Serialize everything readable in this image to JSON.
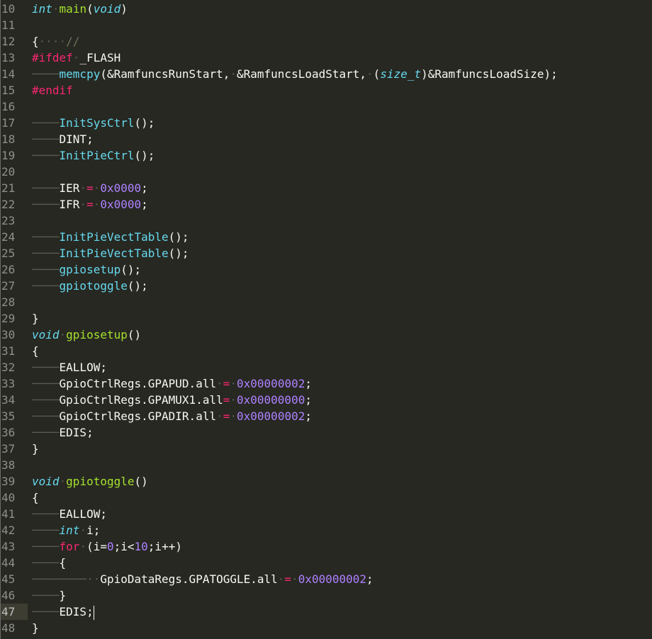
{
  "editor": {
    "theme": {
      "background": "#272822",
      "active_gutter": "#3e3d32"
    },
    "lines": [
      {
        "n": "10",
        "tokens": [
          [
            "kw",
            "int"
          ],
          [
            "ws",
            "·"
          ],
          [
            "fn",
            "main"
          ],
          [
            "id",
            "("
          ],
          [
            "kw",
            "void"
          ],
          [
            "id",
            ")"
          ]
        ]
      },
      {
        "n": "11",
        "tokens": []
      },
      {
        "n": "12",
        "tokens": [
          [
            "id",
            "{"
          ],
          [
            "ws",
            "····"
          ],
          [
            "cm",
            "//"
          ]
        ]
      },
      {
        "n": "13",
        "tokens": [
          [
            "pre",
            "#ifdef"
          ],
          [
            "ws",
            "·"
          ],
          [
            "id",
            "_FLASH"
          ]
        ]
      },
      {
        "n": "14",
        "tokens": [
          [
            "tab",
            "────"
          ],
          [
            "call",
            "memcpy"
          ],
          [
            "id",
            "(&RamfuncsRunStart,"
          ],
          [
            "ws",
            "·"
          ],
          [
            "id",
            "&RamfuncsLoadStart,"
          ],
          [
            "ws",
            "·"
          ],
          [
            "id",
            "("
          ],
          [
            "kw",
            "size_t"
          ],
          [
            "id",
            ")&RamfuncsLoadSize);"
          ]
        ]
      },
      {
        "n": "15",
        "tokens": [
          [
            "pre",
            "#endif"
          ]
        ]
      },
      {
        "n": "16",
        "tokens": []
      },
      {
        "n": "17",
        "tokens": [
          [
            "tab",
            "────"
          ],
          [
            "call",
            "InitSysCtrl"
          ],
          [
            "id",
            "();"
          ]
        ]
      },
      {
        "n": "18",
        "tokens": [
          [
            "tab",
            "────"
          ],
          [
            "id",
            "DINT;"
          ]
        ]
      },
      {
        "n": "19",
        "tokens": [
          [
            "tab",
            "────"
          ],
          [
            "call",
            "InitPieCtrl"
          ],
          [
            "id",
            "();"
          ]
        ]
      },
      {
        "n": "20",
        "tokens": []
      },
      {
        "n": "21",
        "tokens": [
          [
            "tab",
            "────"
          ],
          [
            "id",
            "IER"
          ],
          [
            "ws",
            "·"
          ],
          [
            "ctl",
            "="
          ],
          [
            "ws",
            "·"
          ],
          [
            "num",
            "0x0000"
          ],
          [
            "id",
            ";"
          ]
        ]
      },
      {
        "n": "22",
        "tokens": [
          [
            "tab",
            "────"
          ],
          [
            "id",
            "IFR"
          ],
          [
            "ws",
            "·"
          ],
          [
            "ctl",
            "="
          ],
          [
            "ws",
            "·"
          ],
          [
            "num",
            "0x0000"
          ],
          [
            "id",
            ";"
          ]
        ]
      },
      {
        "n": "23",
        "tokens": []
      },
      {
        "n": "24",
        "tokens": [
          [
            "tab",
            "────"
          ],
          [
            "call",
            "InitPieVectTable"
          ],
          [
            "id",
            "();"
          ]
        ]
      },
      {
        "n": "25",
        "tokens": [
          [
            "tab",
            "────"
          ],
          [
            "call",
            "InitPieVectTable"
          ],
          [
            "id",
            "();"
          ]
        ]
      },
      {
        "n": "26",
        "tokens": [
          [
            "tab",
            "────"
          ],
          [
            "call",
            "gpiosetup"
          ],
          [
            "id",
            "();"
          ]
        ]
      },
      {
        "n": "27",
        "tokens": [
          [
            "tab",
            "────"
          ],
          [
            "call",
            "gpiotoggle"
          ],
          [
            "id",
            "();"
          ]
        ]
      },
      {
        "n": "28",
        "tokens": []
      },
      {
        "n": "29",
        "tokens": [
          [
            "id",
            "}"
          ]
        ]
      },
      {
        "n": "30",
        "tokens": [
          [
            "kw",
            "void"
          ],
          [
            "ws",
            "·"
          ],
          [
            "fn",
            "gpiosetup"
          ],
          [
            "id",
            "()"
          ]
        ]
      },
      {
        "n": "31",
        "tokens": [
          [
            "id",
            "{"
          ]
        ]
      },
      {
        "n": "32",
        "tokens": [
          [
            "tab",
            "────"
          ],
          [
            "id",
            "EALLOW;"
          ]
        ]
      },
      {
        "n": "33",
        "tokens": [
          [
            "tab",
            "────"
          ],
          [
            "id",
            "GpioCtrlRegs.GPAPUD.all"
          ],
          [
            "ws",
            "·"
          ],
          [
            "ctl",
            "="
          ],
          [
            "ws",
            "·"
          ],
          [
            "num",
            "0x00000002"
          ],
          [
            "id",
            ";"
          ]
        ]
      },
      {
        "n": "34",
        "tokens": [
          [
            "tab",
            "────"
          ],
          [
            "id",
            "GpioCtrlRegs.GPAMUX1.all"
          ],
          [
            "ctl",
            "="
          ],
          [
            "ws",
            "·"
          ],
          [
            "num",
            "0x00000000"
          ],
          [
            "id",
            ";"
          ]
        ]
      },
      {
        "n": "35",
        "tokens": [
          [
            "tab",
            "────"
          ],
          [
            "id",
            "GpioCtrlRegs.GPADIR.all"
          ],
          [
            "ws",
            "·"
          ],
          [
            "ctl",
            "="
          ],
          [
            "ws",
            "·"
          ],
          [
            "num",
            "0x00000002"
          ],
          [
            "id",
            ";"
          ]
        ]
      },
      {
        "n": "36",
        "tokens": [
          [
            "tab",
            "────"
          ],
          [
            "id",
            "EDIS;"
          ]
        ]
      },
      {
        "n": "37",
        "tokens": [
          [
            "id",
            "}"
          ]
        ]
      },
      {
        "n": "38",
        "tokens": []
      },
      {
        "n": "39",
        "tokens": [
          [
            "kw",
            "void"
          ],
          [
            "ws",
            "·"
          ],
          [
            "fn",
            "gpiotoggle"
          ],
          [
            "id",
            "()"
          ]
        ]
      },
      {
        "n": "40",
        "tokens": [
          [
            "id",
            "{"
          ]
        ]
      },
      {
        "n": "41",
        "tokens": [
          [
            "tab",
            "────"
          ],
          [
            "id",
            "EALLOW;"
          ]
        ]
      },
      {
        "n": "42",
        "tokens": [
          [
            "tab",
            "────"
          ],
          [
            "kw",
            "int"
          ],
          [
            "ws",
            "·"
          ],
          [
            "id",
            "i;"
          ]
        ]
      },
      {
        "n": "43",
        "tokens": [
          [
            "tab",
            "────"
          ],
          [
            "ctl",
            "for"
          ],
          [
            "ws",
            "·"
          ],
          [
            "id",
            "(i="
          ],
          [
            "num",
            "0"
          ],
          [
            "id",
            ";i<"
          ],
          [
            "num",
            "10"
          ],
          [
            "id",
            ";i++)"
          ]
        ]
      },
      {
        "n": "44",
        "tokens": [
          [
            "tab",
            "────"
          ],
          [
            "id",
            "{"
          ]
        ]
      },
      {
        "n": "45",
        "tokens": [
          [
            "tab",
            "────────"
          ],
          [
            "ws",
            "··"
          ],
          [
            "id",
            "GpioDataRegs.GPATOGGLE.all"
          ],
          [
            "ws",
            "·"
          ],
          [
            "ctl",
            "="
          ],
          [
            "ws",
            "·"
          ],
          [
            "num",
            "0x00000002"
          ],
          [
            "id",
            ";"
          ]
        ]
      },
      {
        "n": "46",
        "tokens": [
          [
            "tab",
            "────"
          ],
          [
            "id",
            "}"
          ]
        ]
      },
      {
        "n": "47",
        "tokens": [
          [
            "tab",
            "────"
          ],
          [
            "id",
            "EDIS;"
          ],
          [
            "cursor",
            ""
          ]
        ],
        "active": true
      },
      {
        "n": "48",
        "tokens": [
          [
            "id",
            "}"
          ]
        ]
      }
    ]
  }
}
